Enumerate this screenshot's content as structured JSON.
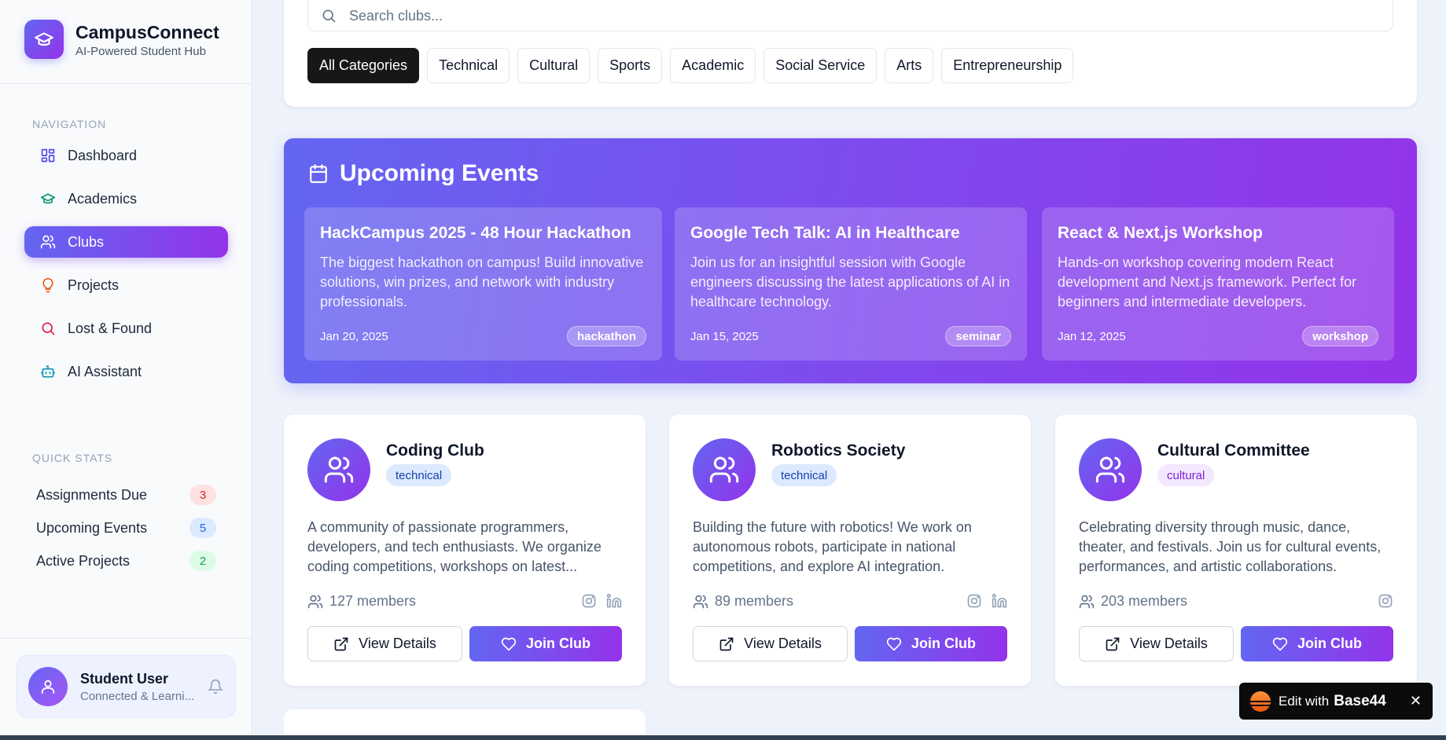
{
  "brand": {
    "name": "CampusConnect",
    "subtitle": "AI-Powered Student Hub"
  },
  "sidebar": {
    "nav_label": "NAVIGATION",
    "items": [
      {
        "label": "Dashboard",
        "icon": "layout-grid-icon",
        "active": false
      },
      {
        "label": "Academics",
        "icon": "graduation-cap-icon",
        "active": false
      },
      {
        "label": "Clubs",
        "icon": "users-icon",
        "active": true
      },
      {
        "label": "Projects",
        "icon": "lightbulb-icon",
        "active": false
      },
      {
        "label": "Lost & Found",
        "icon": "search-icon",
        "active": false
      },
      {
        "label": "AI Assistant",
        "icon": "bot-icon",
        "active": false
      }
    ],
    "stats_label": "QUICK STATS",
    "stats": [
      {
        "label": "Assignments Due",
        "value": "3",
        "color": "red"
      },
      {
        "label": "Upcoming Events",
        "value": "5",
        "color": "blue"
      },
      {
        "label": "Active Projects",
        "value": "2",
        "color": "green"
      }
    ],
    "user": {
      "name": "Student User",
      "status": "Connected & Learni..."
    }
  },
  "search": {
    "placeholder": "Search clubs..."
  },
  "categories": [
    "All Categories",
    "Technical",
    "Cultural",
    "Sports",
    "Academic",
    "Social Service",
    "Arts",
    "Entrepreneurship"
  ],
  "events": {
    "title": "Upcoming Events",
    "items": [
      {
        "title": "HackCampus 2025 - 48 Hour Hackathon",
        "description": "The biggest hackathon on campus! Build innovative solutions, win prizes, and network with industry professionals.",
        "date": "Jan 20, 2025",
        "tag": "hackathon"
      },
      {
        "title": "Google Tech Talk: AI in Healthcare",
        "description": "Join us for an insightful session with Google engineers discussing the latest applications of AI in healthcare technology.",
        "date": "Jan 15, 2025",
        "tag": "seminar"
      },
      {
        "title": "React & Next.js Workshop",
        "description": "Hands-on workshop covering modern React development and Next.js framework. Perfect for beginners and intermediate developers.",
        "date": "Jan 12, 2025",
        "tag": "workshop"
      }
    ]
  },
  "clubs": [
    {
      "name": "Coding Club",
      "category": "technical",
      "description": "A community of passionate programmers, developers, and tech enthusiasts. We organize coding competitions, workshops on latest...",
      "members": "127 members",
      "socials": [
        "instagram-icon",
        "linkedin-icon"
      ]
    },
    {
      "name": "Robotics Society",
      "category": "technical",
      "description": "Building the future with robotics! We work on autonomous robots, participate in national competitions, and explore AI integration.",
      "members": "89 members",
      "socials": [
        "instagram-icon",
        "linkedin-icon"
      ]
    },
    {
      "name": "Cultural Committee",
      "category": "cultural",
      "description": "Celebrating diversity through music, dance, theater, and festivals. Join us for cultural events, performances, and artistic collaborations.",
      "members": "203 members",
      "socials": [
        "instagram-icon"
      ]
    }
  ],
  "buttons": {
    "view": "View Details",
    "join": "Join Club"
  },
  "badge": {
    "text": "Edit with",
    "brand": "Base44"
  },
  "colors": {
    "accent_start": "#6366f1",
    "accent_end": "#9333ea"
  }
}
